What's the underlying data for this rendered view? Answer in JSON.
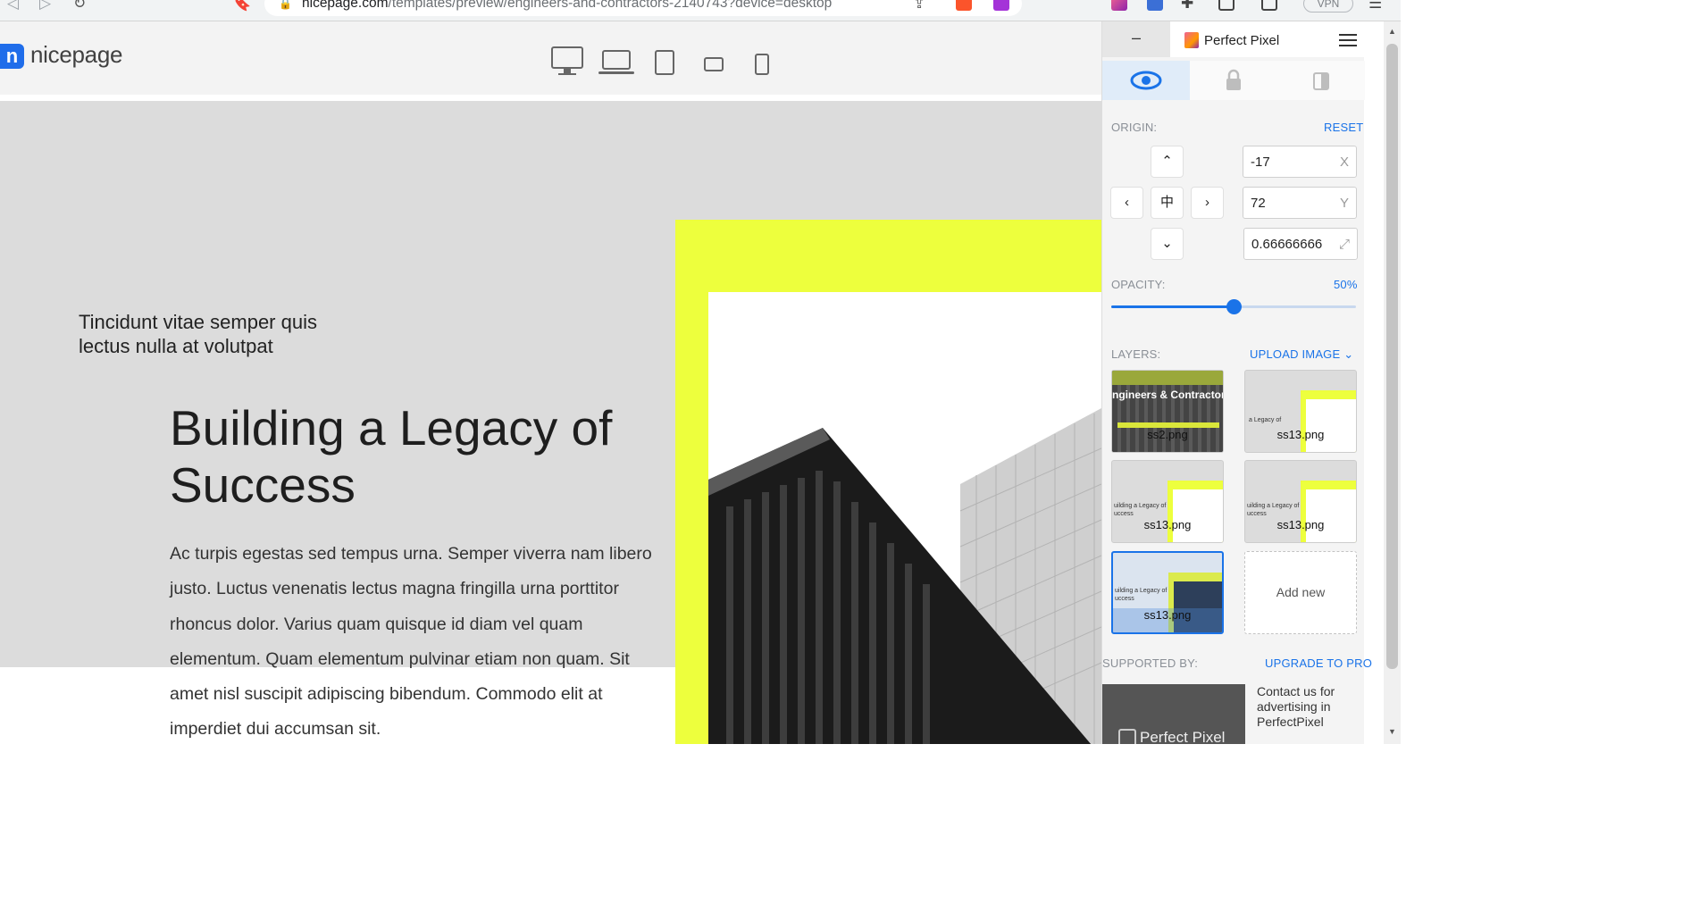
{
  "browser": {
    "url_host": "nicepage.com",
    "url_path": "/templates/preview/engineers-and-contractors-2140743?device=desktop",
    "vpn_label": "VPN"
  },
  "site": {
    "logo_letter": "n",
    "logo_text": "nicepage",
    "devices": [
      "desktop-icon",
      "laptop-icon",
      "tablet-icon",
      "tablet-landscape-icon",
      "phone-icon"
    ],
    "tagline": "Tincidunt vitae semper quis lectus nulla at volutpat",
    "headline": "Building a Legacy of Success",
    "body": "Ac turpis egestas sed tempus urna. Semper viverra nam libero justo. Luctus venenatis lectus magna fringilla urna porttitor rhoncus dolor. Varius quam quisque id diam vel quam elementum. Quam elementum pulvinar etiam non quam. Sit amet nisl suscipit adipiscing bibendum. Commodo elit at imperdiet dui accumsan sit.",
    "colors": {
      "accent_yellow": "#edff3d",
      "hero_gray": "#dcdcdc",
      "logo_blue": "#1f6dea"
    }
  },
  "panel": {
    "minimize_label": "–",
    "title": "Perfect Pixel",
    "origin_label": "ORIGIN:",
    "reset_label": "RESET",
    "center_label": "中",
    "x_value": "-17",
    "x_suffix": "X",
    "y_value": "72",
    "y_suffix": "Y",
    "scale_value": "0.66666666",
    "opacity_label": "OPACITY:",
    "opacity_value": "50%",
    "opacity_fraction": 0.5,
    "layers_label": "LAYERS:",
    "upload_label": "UPLOAD IMAGE",
    "layers": [
      {
        "name": "ss2.png",
        "title": "ngineers & Contractor",
        "selected": false
      },
      {
        "name": "ss13.png",
        "selected": false
      },
      {
        "name": "ss13.png",
        "selected": false
      },
      {
        "name": "ss13.png",
        "selected": false
      },
      {
        "name": "ss13.png",
        "selected": true
      }
    ],
    "add_new_label": "Add new",
    "supported_label": "SUPPORTED BY:",
    "upgrade_label": "UPGRADE TO PRO",
    "ad_text": "Contact us for advertising in PerfectPixel",
    "ad_brand": "Perfect Pixel",
    "accent": "#1a73e8"
  }
}
